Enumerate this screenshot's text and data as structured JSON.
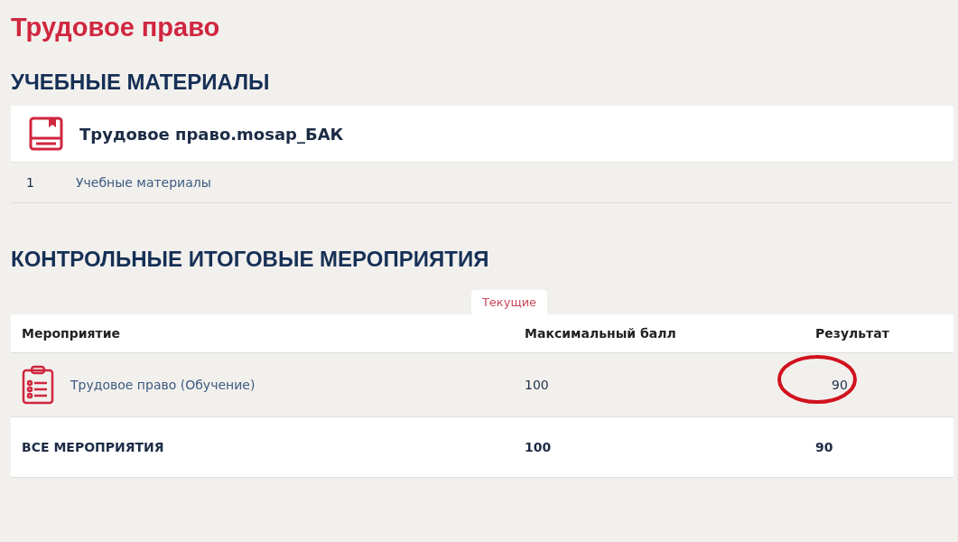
{
  "title": "Трудовое право",
  "materials": {
    "heading": "УЧЕБНЫЕ МАТЕРИАЛЫ",
    "course": "Трудовое право.mosap_БАК",
    "items": [
      {
        "number": "1",
        "label": "Учебные материалы"
      }
    ]
  },
  "control": {
    "heading": "КОНТРОЛЬНЫЕ ИТОГОВЫЕ МЕРОПРИЯТИЯ",
    "tabs": [
      {
        "label": "Текущие",
        "selected": true
      }
    ],
    "columns": [
      "Мероприятие",
      "Максимальный балл",
      "Результат"
    ],
    "rows": [
      {
        "name": "Трудовое право (Обучение)",
        "max": "100",
        "result": "90",
        "circled": true
      }
    ],
    "total": {
      "label": "ВСЕ МЕРОПРИЯТИЯ",
      "max": "100",
      "result": "90"
    }
  }
}
